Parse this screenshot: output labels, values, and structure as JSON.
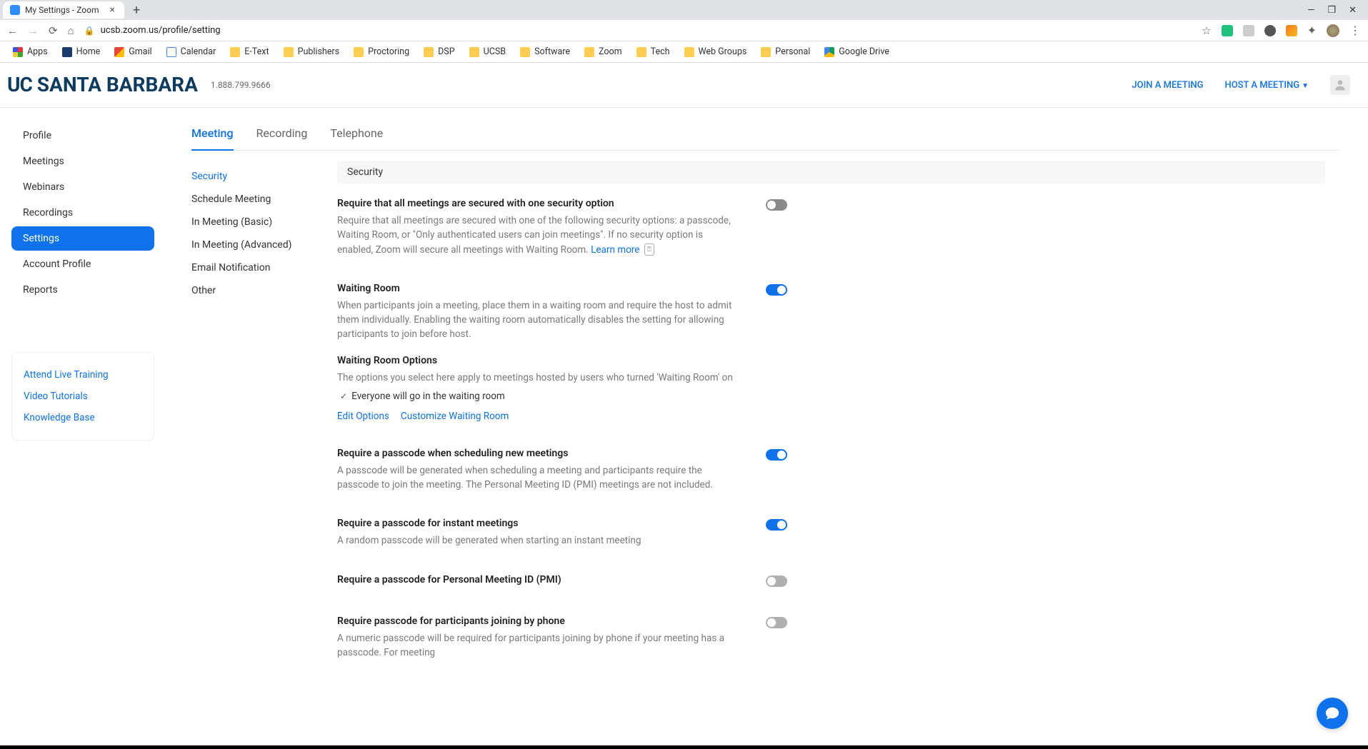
{
  "browser": {
    "tab_title": "My Settings - Zoom",
    "url": "ucsb.zoom.us/profile/setting",
    "bookmarks": [
      "Apps",
      "Home",
      "Gmail",
      "Calendar",
      "E-Text",
      "Publishers",
      "Proctoring",
      "DSP",
      "UCSB",
      "Software",
      "Zoom",
      "Tech",
      "Web Groups",
      "Personal",
      "Google Drive"
    ]
  },
  "header": {
    "brand": "UC SANTA BARBARA",
    "phone": "1.888.799.9666",
    "join": "JOIN A MEETING",
    "host": "HOST A MEETING"
  },
  "sidebar": {
    "items": [
      "Profile",
      "Meetings",
      "Webinars",
      "Recordings",
      "Settings",
      "Account Profile",
      "Reports"
    ],
    "active_index": 4,
    "support": [
      "Attend Live Training",
      "Video Tutorials",
      "Knowledge Base"
    ]
  },
  "tabs": {
    "items": [
      "Meeting",
      "Recording",
      "Telephone"
    ],
    "active_index": 0
  },
  "subnav": {
    "items": [
      "Security",
      "Schedule Meeting",
      "In Meeting (Basic)",
      "In Meeting (Advanced)",
      "Email Notification",
      "Other"
    ],
    "active_index": 0
  },
  "section_header": "Security",
  "settings": [
    {
      "title": "Require that all meetings are secured with one security option",
      "desc": "Require that all meetings are secured with one of the following security options: a passcode, Waiting Room, or \"Only authenticated users can join meetings\". If no security option is enabled, Zoom will secure all meetings with Waiting Room.",
      "learn_more": "Learn more",
      "state": "disabled"
    },
    {
      "title": "Waiting Room",
      "desc": "When participants join a meeting, place them in a waiting room and require the host to admit them individually. Enabling the waiting room automatically disables the setting for allowing participants to join before host.",
      "state": "on",
      "options_title": "Waiting Room Options",
      "options_desc": "The options you select here apply to meetings hosted by users who turned 'Waiting Room' on",
      "option_line": "Everyone will go in the waiting room",
      "edit": "Edit Options",
      "customize": "Customize Waiting Room"
    },
    {
      "title": "Require a passcode when scheduling new meetings",
      "desc": "A passcode will be generated when scheduling a meeting and participants require the passcode to join the meeting. The Personal Meeting ID (PMI) meetings are not included.",
      "state": "on"
    },
    {
      "title": "Require a passcode for instant meetings",
      "desc": "A random passcode will be generated when starting an instant meeting",
      "state": "on"
    },
    {
      "title": "Require a passcode for Personal Meeting ID (PMI)",
      "desc": "",
      "state": "off"
    },
    {
      "title": "Require passcode for participants joining by phone",
      "desc": "A numeric passcode will be required for participants joining by phone if your meeting has a passcode. For meeting",
      "state": "off"
    }
  ]
}
